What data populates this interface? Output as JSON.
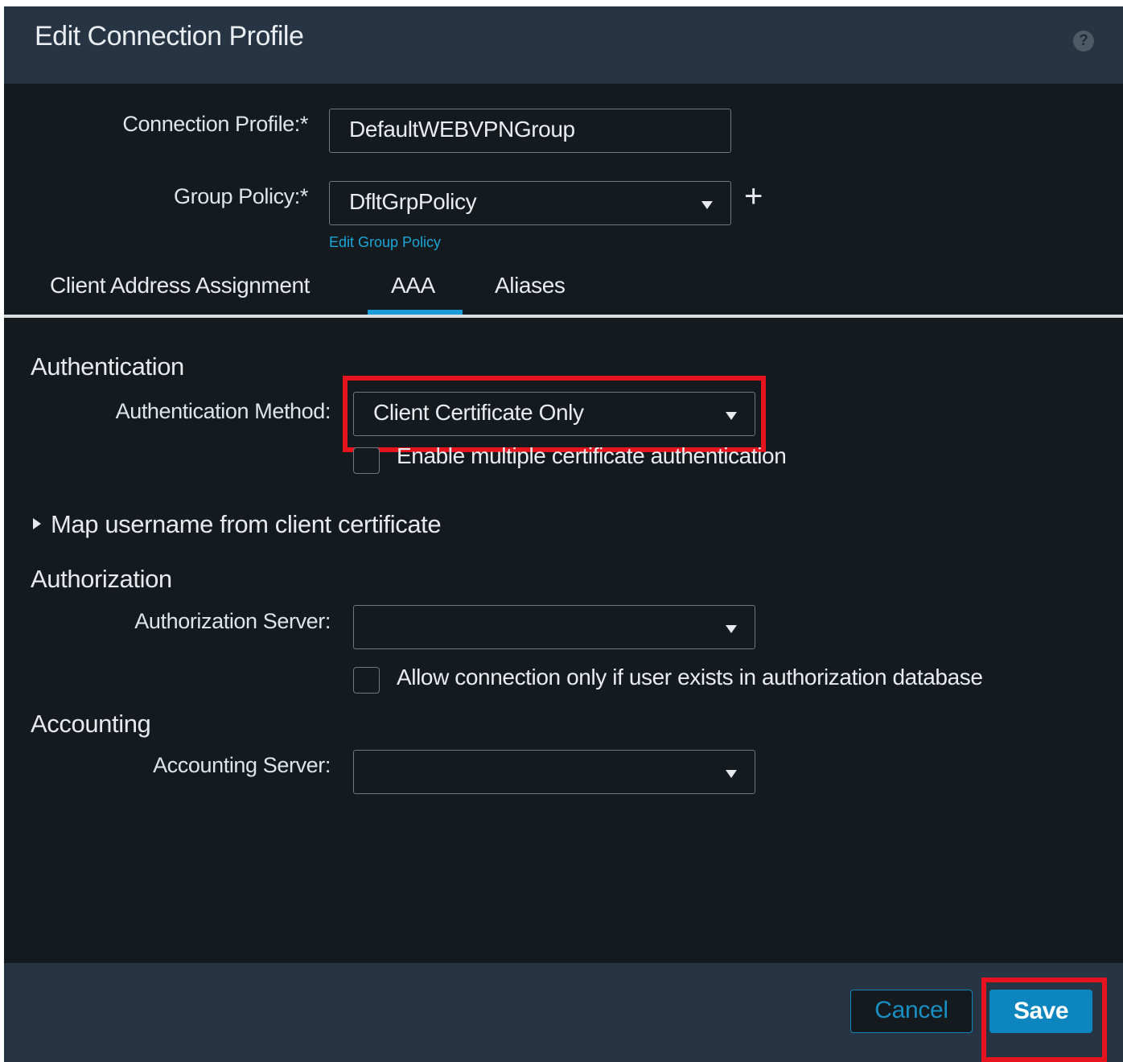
{
  "dialog": {
    "title": "Edit Connection Profile",
    "help_icon": "question-circle-icon"
  },
  "form": {
    "connection_profile_label": "Connection Profile:*",
    "connection_profile_value": "DefaultWEBVPNGroup",
    "group_policy_label": "Group Policy:*",
    "group_policy_value": "DfltGrpPolicy",
    "add_icon": "plus-icon",
    "edit_group_policy_link": "Edit Group Policy"
  },
  "tabs": [
    {
      "label": "Client Address Assignment",
      "active": false
    },
    {
      "label": "AAA",
      "active": true
    },
    {
      "label": "Aliases",
      "active": false
    }
  ],
  "authentication": {
    "heading": "Authentication",
    "method_label": "Authentication Method:",
    "method_value": "Client Certificate Only",
    "multi_cert_label": "Enable multiple certificate authentication",
    "multi_cert_checked": false,
    "map_username_label": "Map username from client certificate"
  },
  "authorization": {
    "heading": "Authorization",
    "server_label": "Authorization Server:",
    "server_value": "",
    "allow_only_label": "Allow connection only if user exists in authorization database",
    "allow_only_checked": false
  },
  "accounting": {
    "heading": "Accounting",
    "server_label": "Accounting Server:",
    "server_value": ""
  },
  "footer": {
    "cancel_label": "Cancel",
    "save_label": "Save"
  },
  "colors": {
    "header_bg": "#263443",
    "body_bg": "#141a1d",
    "accent": "#1a9bd7",
    "highlight": "#e5141e"
  }
}
